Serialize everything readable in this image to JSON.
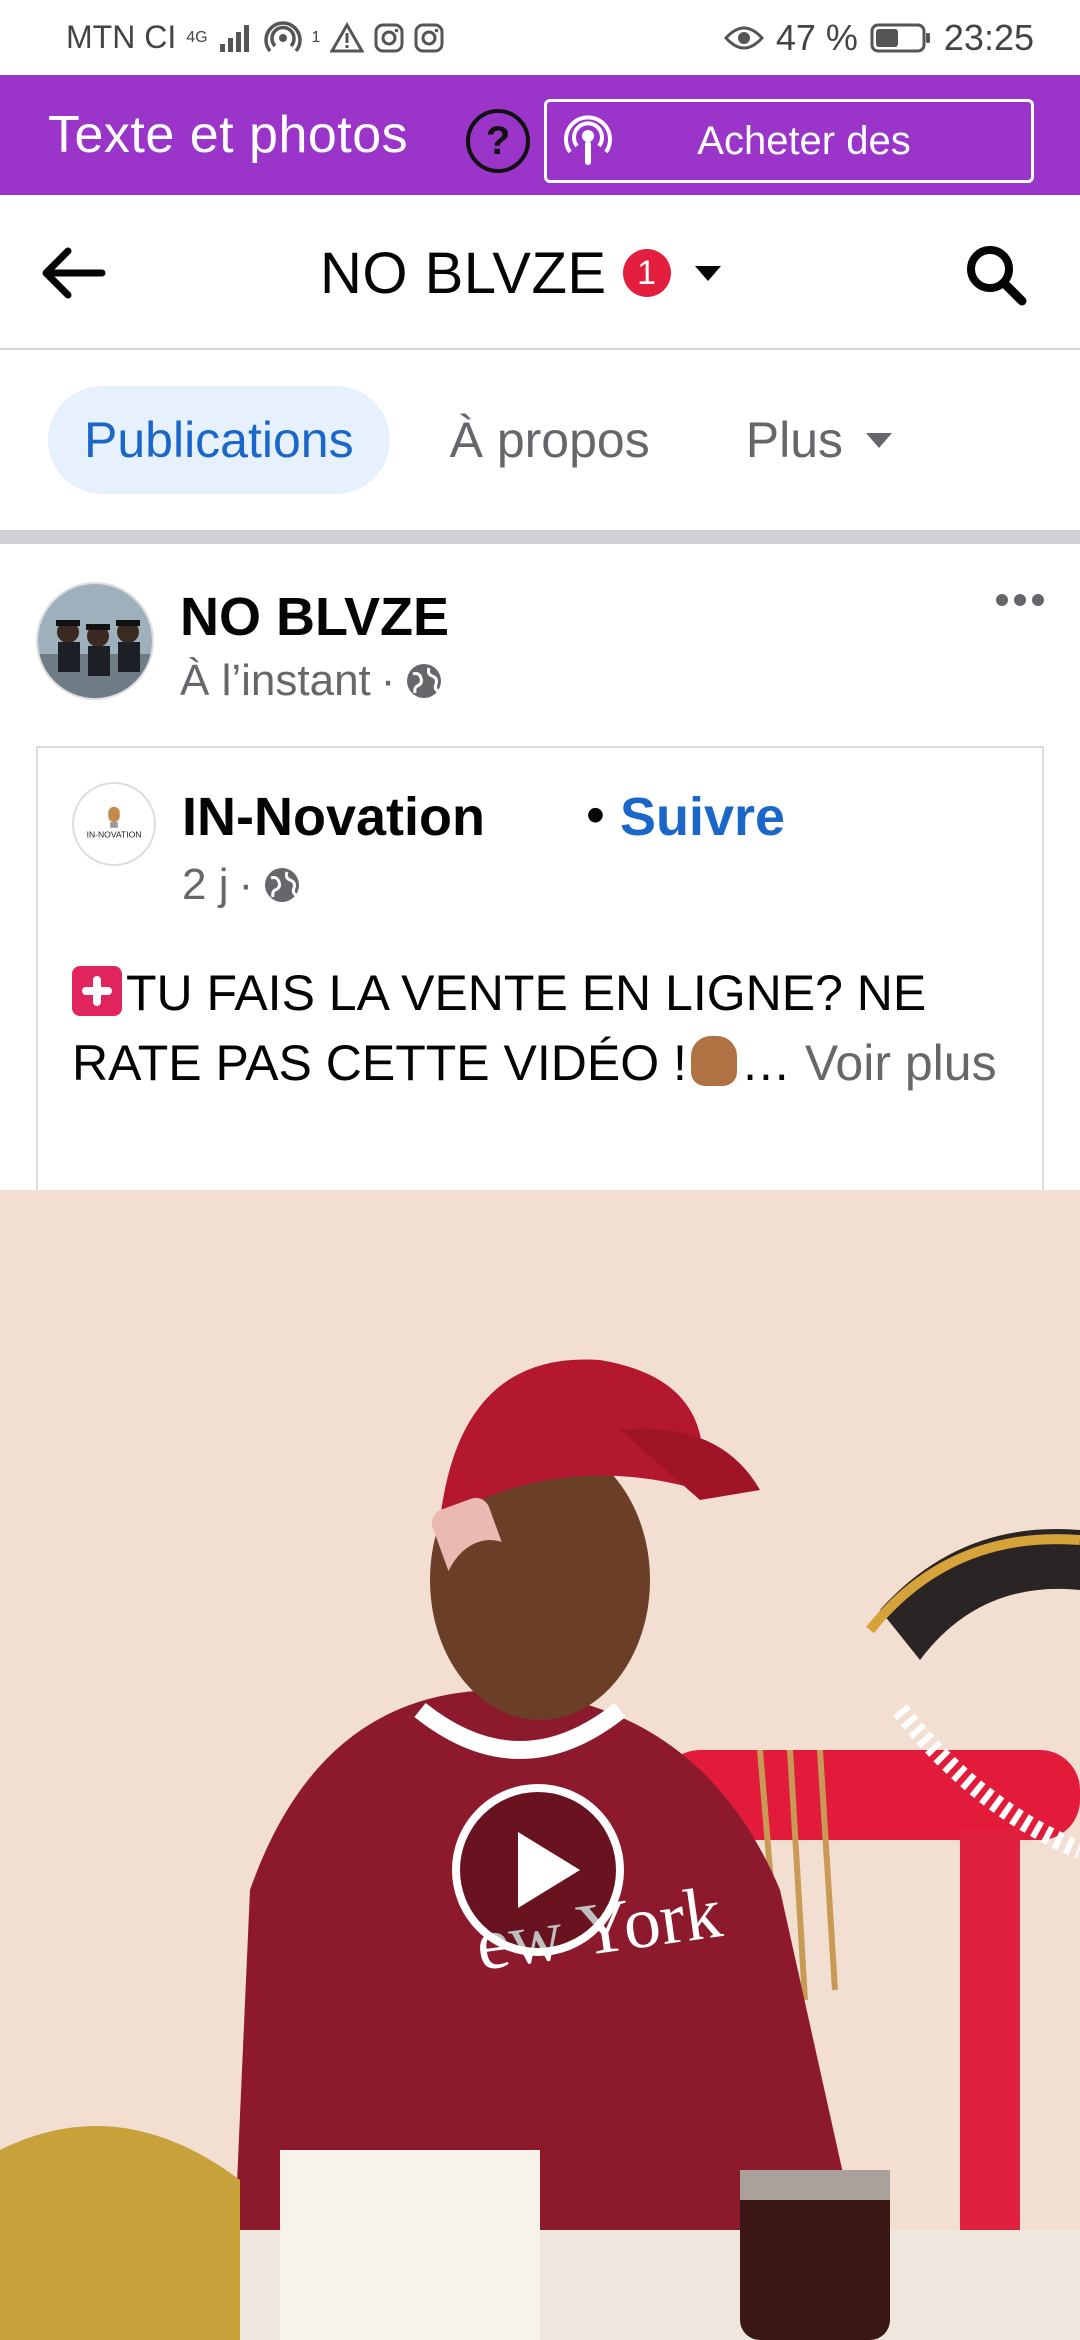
{
  "status_bar": {
    "carrier": "MTN CI",
    "network_type": "4G",
    "wifi_sub": "1",
    "battery": "47 %",
    "time": "23:25"
  },
  "promo": {
    "title": "Texte et photos",
    "help_symbol": "?",
    "button_label": "Acheter des"
  },
  "header": {
    "page_title": "NO BLVZE",
    "notification_count": "1"
  },
  "tabs": [
    {
      "label": "Publications",
      "active": true
    },
    {
      "label": "À propos",
      "active": false
    },
    {
      "label": "Plus",
      "active": false
    }
  ],
  "post": {
    "author": "NO BLVZE",
    "time": "À l’instant",
    "time_separator": "·",
    "shared": {
      "logo_text": "IN-NOVATION",
      "author": "IN-Novation",
      "dot": "•",
      "follow_label": "Suivre",
      "time": "2 j",
      "time_separator": "·",
      "text_part1": "TU FAIS LA VENTE EN LIGNE? NE RATE PAS CETTE VIDÉO !",
      "ellipsis": "…",
      "see_more": "Voir plus"
    },
    "video": {
      "has_play_button": true
    }
  },
  "colors": {
    "promo_bg": "#9b35c9",
    "facebook_blue": "#1b66c9",
    "active_tab_bg": "#e7f1fd",
    "badge_red": "#e41e3f",
    "secondary_text": "#65676b"
  }
}
